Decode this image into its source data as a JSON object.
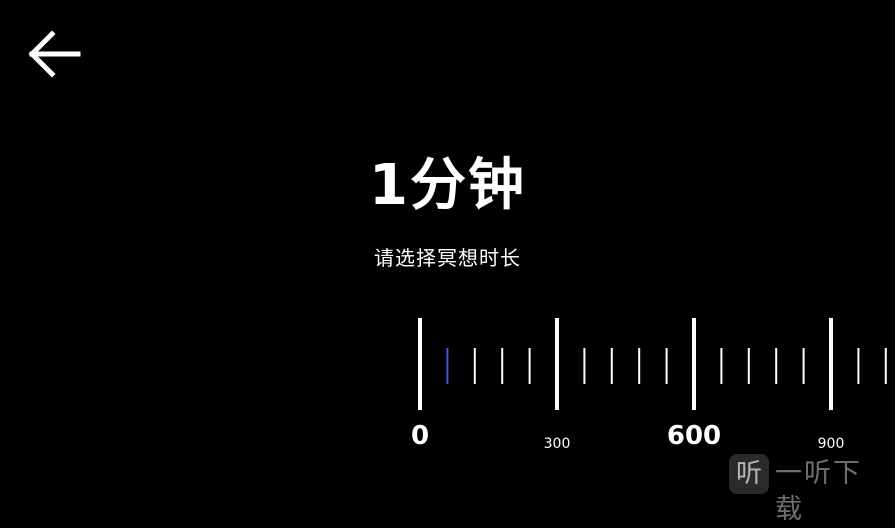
{
  "nav": {
    "back_icon": "arrow-left-icon"
  },
  "header": {
    "title": "1分钟",
    "subtitle": "请选择冥想时长"
  },
  "ruler": {
    "labels": [
      {
        "text": "0",
        "size": "major"
      },
      {
        "text": "300",
        "size": "minor"
      },
      {
        "text": "600",
        "size": "major"
      },
      {
        "text": "900",
        "size": "minor"
      }
    ],
    "selected_value_minutes": 1,
    "colors": {
      "tick": "#ffffff",
      "selected_tick": "#3a5bd9",
      "background": "#000000"
    }
  },
  "watermark": {
    "logo_glyph": "听",
    "text": "一听下载"
  }
}
